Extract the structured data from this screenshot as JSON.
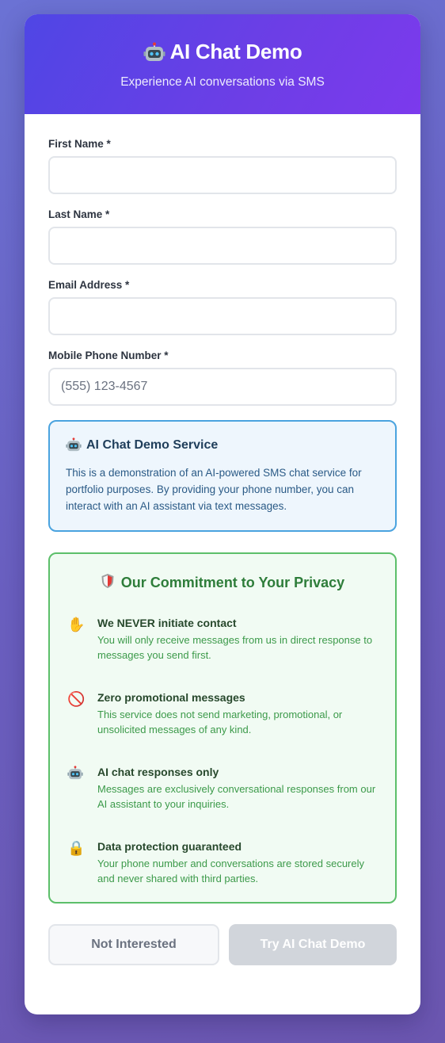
{
  "header": {
    "title": "AI Chat Demo",
    "subtitle": "Experience AI conversations via SMS",
    "icon": "robot-icon"
  },
  "form": {
    "first_name": {
      "label": "First Name *",
      "value": "",
      "placeholder": ""
    },
    "last_name": {
      "label": "Last Name *",
      "value": "",
      "placeholder": ""
    },
    "email": {
      "label": "Email Address *",
      "value": "",
      "placeholder": ""
    },
    "phone": {
      "label": "Mobile Phone Number *",
      "value": "",
      "placeholder": "(555) 123-4567"
    }
  },
  "info": {
    "title": "AI Chat Demo Service",
    "text": "This is a demonstration of an AI-powered SMS chat service for portfolio purposes. By providing your phone number, you can interact with an AI assistant via text messages."
  },
  "privacy": {
    "title": "Our Commitment to Your Privacy",
    "items": [
      {
        "icon": "raised-hand-icon",
        "glyph": "✋",
        "heading": "We NEVER initiate contact",
        "text": "You will only receive messages from us in direct response to messages you send first."
      },
      {
        "icon": "prohibited-icon",
        "glyph": "🚫",
        "heading": "Zero promotional messages",
        "text": "This service does not send marketing, promotional, or unsolicited messages of any kind."
      },
      {
        "icon": "robot-icon",
        "glyph": "",
        "heading": "AI chat responses only",
        "text": "Messages are exclusively conversational responses from our AI assistant to your inquiries."
      },
      {
        "icon": "lock-icon",
        "glyph": "🔒",
        "heading": "Data protection guaranteed",
        "text": "Your phone number and conversations are stored securely and never shared with third parties."
      }
    ]
  },
  "actions": {
    "decline_label": "Not Interested",
    "submit_label": "Try AI Chat Demo"
  },
  "colors": {
    "header_gradient_start": "#4f46e5",
    "header_gradient_end": "#7c3aed",
    "info_border": "#4aa3df",
    "privacy_border": "#5cbf6a",
    "privacy_title": "#2e7d3a",
    "submit_disabled": "#d1d5db"
  }
}
